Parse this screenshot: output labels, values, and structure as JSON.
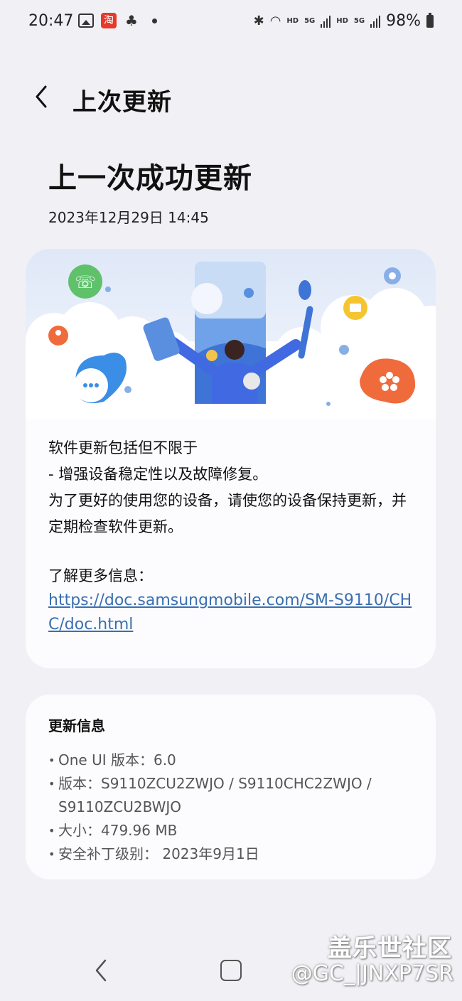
{
  "status_bar": {
    "time": "20:47",
    "battery": "98%",
    "hd1": "HD",
    "hd2": "HD",
    "net1": "5G",
    "net2": "5G"
  },
  "header": {
    "back_icon": "chevron-left-icon",
    "title": "上次更新"
  },
  "hero": {
    "title": "上一次成功更新",
    "date": "2023年12月29日 14:45"
  },
  "release_notes": {
    "lines": [
      "软件更新包括但不限于",
      "- 增强设备稳定性以及故障修复。",
      "为了更好的使用您的设备，请使您的设备保持更新，并定期检查软件更新。"
    ],
    "more_label": "了解更多信息：",
    "link": "https://doc.samsungmobile.com/SM-S9110/CHC/doc.html"
  },
  "update_info": {
    "heading": "更新信息",
    "items": [
      "One UI 版本：6.0",
      "版本：S9110ZCU2ZWJO / S9110CHC2ZWJO / S9110ZCU2BWJO",
      "大小：479.96 MB",
      "安全补丁级别： 2023年9月1日"
    ]
  },
  "nav": {
    "back_icon": "nav-back-icon",
    "home_icon": "nav-home-icon"
  },
  "watermark": {
    "line1": "盖乐世社区",
    "line2": "@GC_|JNXP7SR"
  },
  "colors": {
    "background": "#f1f1f5",
    "card": "#fcfcfe",
    "link": "#3a6fb0"
  }
}
